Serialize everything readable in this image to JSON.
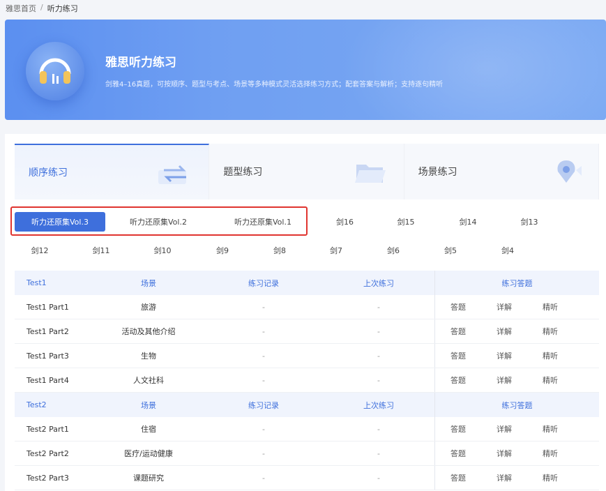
{
  "breadcrumb": {
    "home": "雅思首页",
    "separator": "/",
    "current": "听力练习"
  },
  "banner": {
    "title": "雅思听力练习",
    "description": "剑雅4–16真题，可按顺序、题型与考点、场景等多种模式灵活选择练习方式；配套答案与解析；支持逐句精听",
    "icon": "headphones-icon"
  },
  "tabs": [
    {
      "label": "顺序练习",
      "icon": "swap-arrows-icon",
      "active": true
    },
    {
      "label": "题型练习",
      "icon": "folder-icon",
      "active": false
    },
    {
      "label": "场景练习",
      "icon": "location-pin-icon",
      "active": false
    }
  ],
  "volumes_row1": [
    {
      "label": "听力还原集Vol.3",
      "active": true
    },
    {
      "label": "听力还原集Vol.2",
      "active": false
    },
    {
      "label": "听力还原集Vol.1",
      "active": false
    },
    {
      "label": "剑16",
      "active": false
    },
    {
      "label": "剑15",
      "active": false
    },
    {
      "label": "剑14",
      "active": false
    },
    {
      "label": "剑13",
      "active": false
    }
  ],
  "volumes_row2": [
    "剑12",
    "剑11",
    "剑10",
    "剑9",
    "剑8",
    "剑7",
    "剑6",
    "剑5",
    "剑4"
  ],
  "table": {
    "columns": {
      "scene": "场景",
      "record": "练习记录",
      "last": "上次练习",
      "actions": "练习答题"
    },
    "action_labels": {
      "answer": "答题",
      "detail": "详解",
      "listen": "精听"
    },
    "groups": [
      {
        "name": "Test1",
        "rows": [
          {
            "part": "Test1 Part1",
            "scene": "旅游",
            "record": "-",
            "last": "-"
          },
          {
            "part": "Test1 Part2",
            "scene": "活动及其他介绍",
            "record": "-",
            "last": "-"
          },
          {
            "part": "Test1 Part3",
            "scene": "生物",
            "record": "-",
            "last": "-"
          },
          {
            "part": "Test1 Part4",
            "scene": "人文社科",
            "record": "-",
            "last": "-"
          }
        ]
      },
      {
        "name": "Test2",
        "rows": [
          {
            "part": "Test2 Part1",
            "scene": "住宿",
            "record": "-",
            "last": "-"
          },
          {
            "part": "Test2 Part2",
            "scene": "医疗/运动健康",
            "record": "-",
            "last": "-"
          },
          {
            "part": "Test2 Part3",
            "scene": "课题研究",
            "record": "-",
            "last": "-"
          }
        ]
      }
    ]
  },
  "colors": {
    "accent": "#3e6fdc",
    "highlight_box": "#e0342f",
    "banner": "#6f9ff2"
  }
}
